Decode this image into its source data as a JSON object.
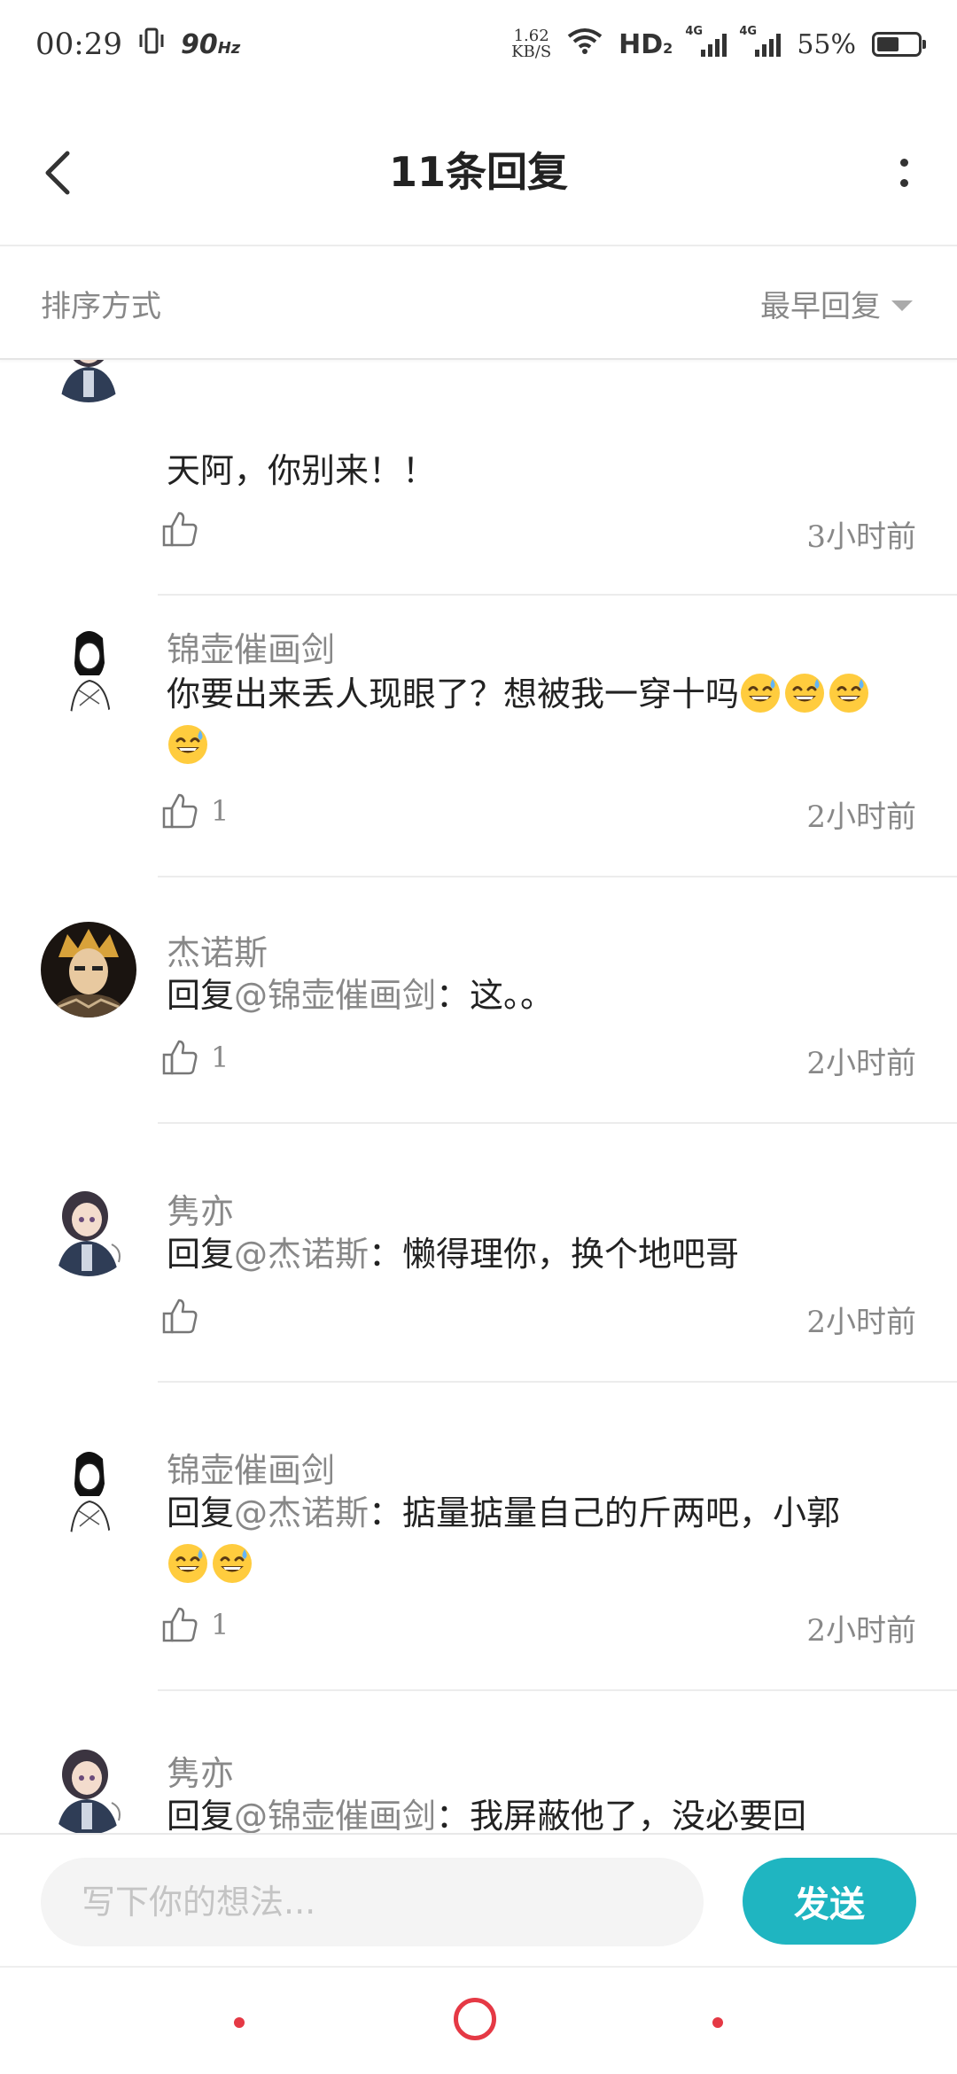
{
  "status_bar": {
    "time": "00:29",
    "refresh_rate": "90",
    "refresh_unit": "Hz",
    "net_speed_value": "1.62",
    "net_speed_unit": "KB/S",
    "hd_label": "HD",
    "hd_sub": "2",
    "network_1": "4G",
    "network_2": "4G",
    "battery_percent": "55%",
    "battery_level": 0.55
  },
  "header": {
    "title": "11条回复"
  },
  "sort": {
    "label": "排序方式",
    "selected": "最早回复"
  },
  "replies": [
    {
      "username": "",
      "content": "天阿，你别来！！",
      "likes": "",
      "time": "3小时前",
      "avatar": "girl-uniform-avatar"
    },
    {
      "username": "锦壶催画剑",
      "content": "你要出来丢人现眼了？想被我一穿十吗",
      "emoji_count": 4,
      "likes": "1",
      "time": "2小时前",
      "avatar": "sketch-girl-avatar"
    },
    {
      "username": "杰诺斯",
      "reply_prefix": "回复",
      "mention": "@锦壶催画剑",
      "content": "：这。。",
      "likes": "1",
      "time": "2小时前",
      "avatar": "cyborg-avatar"
    },
    {
      "username": "隽亦",
      "reply_prefix": "回复",
      "mention": "@杰诺斯",
      "content": "：懒得理你，换个地吧哥",
      "likes": "",
      "time": "2小时前",
      "avatar": "girl-uniform-avatar"
    },
    {
      "username": "锦壶催画剑",
      "reply_prefix": "回复",
      "mention": "@杰诺斯",
      "content": "：掂量掂量自己的斤两吧，小郭",
      "emoji_count": 2,
      "likes": "1",
      "time": "2小时前",
      "avatar": "sketch-girl-avatar"
    },
    {
      "username": "隽亦",
      "reply_prefix": "回复",
      "mention": "@锦壶催画剑",
      "content": "：我屏蔽他了，没必要回",
      "likes": "",
      "time": "",
      "avatar": "girl-uniform-avatar"
    }
  ],
  "composer": {
    "placeholder": "写下你的想法...",
    "send_label": "发送"
  },
  "colors": {
    "accent": "#1fb5c1",
    "nav_red": "#e53945",
    "secondary_text": "#888888"
  }
}
